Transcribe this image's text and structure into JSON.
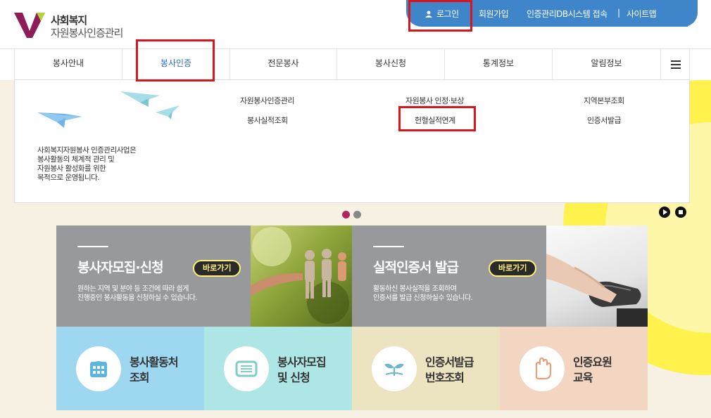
{
  "logo": {
    "line1": "사회복지",
    "line2": "자원봉사인증관리"
  },
  "topbar": {
    "login": "로그인",
    "signup": "회원가입",
    "db_access": "인증관리DB시스템 접속",
    "separator": "|",
    "sitemap": "사이트맵"
  },
  "nav": {
    "items": [
      "봉사안내",
      "봉사인증",
      "전문봉사",
      "봉사신청",
      "통계정보",
      "알림정보"
    ],
    "active": "봉사인증"
  },
  "dropdown": {
    "description": "사회복지자원봉사 인증관리사업은\n봉사활동의 체계적 관리 및\n자원봉사 활성화를 위한\n목적으로 운영됩니다.",
    "links": [
      "자원봉사인증관리",
      "봉사실적조회",
      "자원봉사 인정·보상",
      "헌혈실적연계",
      "지역본부조회",
      "인증서발급"
    ]
  },
  "features": [
    {
      "title": "봉사자모집·신청",
      "button": "바로가기",
      "desc": "원하는 지역 및 분야 등 조건에 따라 쉽게\n진행중인 봉사활동을 신청하실 수 있습니다."
    },
    {
      "title": "실적인증서 발급",
      "button": "바로가기",
      "desc": "활동하신 봉사실적을 조회하여\n인증서를 발급 신청하실수 있습니다."
    }
  ],
  "tiles": [
    {
      "label": "봉사활동처\n조회",
      "icon": "building-icon",
      "color": "#9dd8f0"
    },
    {
      "label": "봉사자모집\n및 신청",
      "icon": "document-icon",
      "color": "#aee6e6"
    },
    {
      "label": "인증서발급\n번호조회",
      "icon": "sprout-icon",
      "color": "#ece3c0"
    },
    {
      "label": "인증요원\n교육",
      "icon": "hand-icon",
      "color": "#f3d6c2"
    }
  ],
  "colors": {
    "topbar": "#3e86c9",
    "highlight": "#d7161e",
    "sun": "#fff24d",
    "slide_dot_active": "#b0245f",
    "slide_dot": "#888888"
  }
}
